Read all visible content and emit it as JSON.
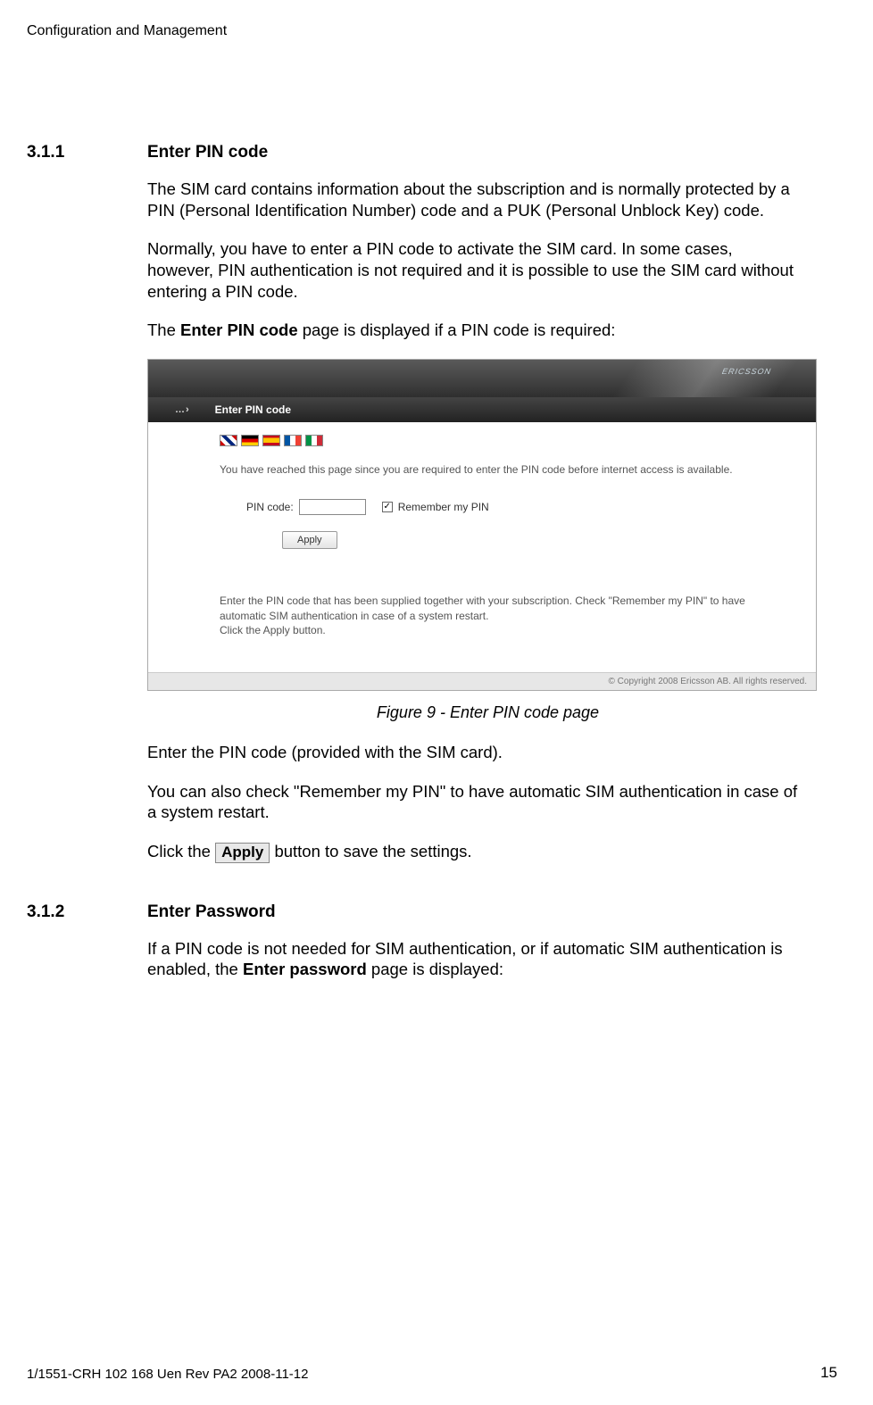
{
  "header": "Configuration and Management",
  "sec311": {
    "num": "3.1.1",
    "title": "Enter PIN code",
    "p1": "The SIM card contains information about the subscription and is normally protected by a PIN (Personal Identification Number) code and a PUK (Personal Unblock Key) code.",
    "p2": "Normally, you have to enter a PIN code to activate the SIM card. In some cases, however, PIN authentication is not required and it is possible to use the SIM card without entering a PIN code.",
    "p3a": "The ",
    "p3b": "Enter PIN code",
    "p3c": " page is displayed if a PIN code is required:",
    "caption": "Figure 9 - Enter PIN code page",
    "p4": "Enter the PIN code (provided with the SIM card).",
    "p5": "You can also check \"Remember my PIN\" to have automatic SIM authentication in case of a system restart.",
    "p6a": "Click the ",
    "p6b": "Apply",
    "p6c": " button to save the settings."
  },
  "screenshot": {
    "logo": "ERICSSON",
    "arrow": "…›",
    "bar_title": "Enter PIN code",
    "intro": "You have reached this page since you are required to enter the PIN code before internet access is available.",
    "pin_label": "PIN code:",
    "remember_label": "Remember my PIN",
    "checkmark": "✓",
    "apply_btn": "Apply",
    "help1": "Enter the PIN code that has been supplied together with your subscription. Check \"Remember my PIN\" to have automatic SIM authentication in case of a system restart.",
    "help2": "Click the Apply button.",
    "copyright": "© Copyright 2008 Ericsson AB. All rights reserved."
  },
  "sec312": {
    "num": "3.1.2",
    "title": "Enter Password",
    "p1a": "If a PIN code is not needed for SIM authentication, or if automatic SIM authentication is enabled, the ",
    "p1b": "Enter password",
    "p1c": " page is displayed:"
  },
  "footer": {
    "docid": "1/1551-CRH 102 168 Uen Rev PA2  2008-11-12",
    "page": "15"
  }
}
